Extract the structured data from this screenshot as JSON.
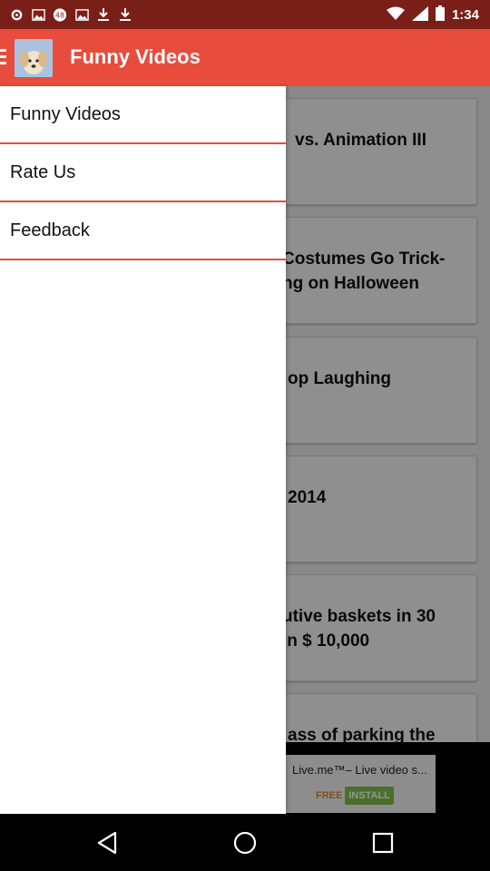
{
  "status_bar": {
    "time": "1:34",
    "left_icons": [
      "settings-icon",
      "image-icon",
      "circle-48-icon",
      "image-icon",
      "download-icon",
      "download-icon"
    ],
    "right_icons": [
      "wifi-icon",
      "signal-icon",
      "battery-icon"
    ],
    "badge_text": "48"
  },
  "app_bar": {
    "title": "Funny Videos"
  },
  "drawer": {
    "items": [
      {
        "label": "Funny Videos"
      },
      {
        "label": "Rate Us"
      },
      {
        "label": "Feedback"
      }
    ]
  },
  "list": {
    "cards": [
      {
        "title": "vs. Animation III"
      },
      {
        "title": "Costumes Go Trick-\nng on Halloween"
      },
      {
        "title": "op Laughing"
      },
      {
        "title": "2014"
      },
      {
        "title": "utive baskets in 30\nin $ 10,000"
      },
      {
        "title": "ass of parking the"
      }
    ]
  },
  "ad": {
    "text": "Live.me™– Live video s...",
    "free_label": "FREE",
    "install_label": "INSTALL"
  },
  "colors": {
    "accent": "#e84c3d",
    "status_bar": "#7a1f17"
  }
}
